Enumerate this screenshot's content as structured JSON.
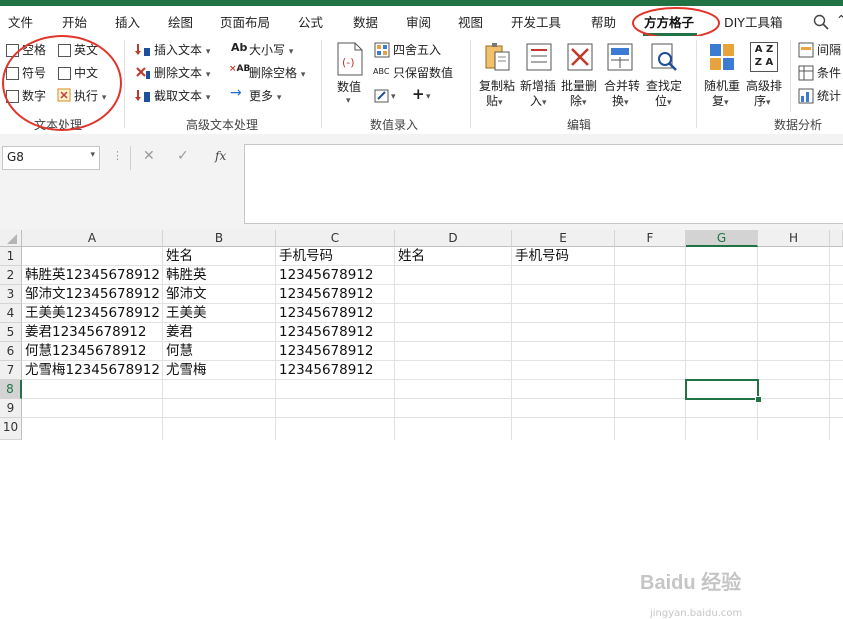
{
  "ribbon_tabs": [
    "文件",
    "开始",
    "插入",
    "绘图",
    "页面布局",
    "公式",
    "数据",
    "审阅",
    "视图",
    "开发工具",
    "帮助",
    "方方格子",
    "DIY工具箱"
  ],
  "active_tab": "方方格子",
  "colors": {
    "accent": "#217346",
    "highlight_circle": "#e0352b"
  },
  "text_group": {
    "checkboxes": [
      {
        "label": "空格",
        "checked": false
      },
      {
        "label": "英文",
        "checked": false
      },
      {
        "label": "符号",
        "checked": false
      },
      {
        "label": "中文",
        "checked": false
      },
      {
        "label": "数字",
        "checked": false
      }
    ],
    "execute_label": "执行",
    "title": "文本处理"
  },
  "advanced_text_group": {
    "insert_text": "插入文本",
    "delete_text": "删除文本",
    "truncate_text": "截取文本",
    "case": "大小写",
    "case_icon_text": "Ab",
    "delete_spaces": "删除空格",
    "delete_spaces_icon_text": "AB",
    "more": "更多",
    "title": "高级文本处理"
  },
  "numeric_group": {
    "value": "数值",
    "round": "四舍五入",
    "keep_numeric": "只保留数值",
    "keep_numeric_icon_text": "ABC",
    "title": "数值录入"
  },
  "edit_group": {
    "copy_paste_1": "复制粘",
    "copy_paste_2": "贴",
    "new_insert_1": "新增插",
    "new_insert_2": "入",
    "batch_delete_1": "批量删",
    "batch_delete_2": "除",
    "merge_convert_1": "合并转",
    "merge_convert_2": "换",
    "find_locate_1": "查找定",
    "find_locate_2": "位",
    "title": "编辑"
  },
  "analysis_group": {
    "random_repeat_1": "随机重",
    "random_repeat_2": "复",
    "advanced_sort_1": "高级排",
    "advanced_sort_2": "序",
    "sort_icon_top": "A Z",
    "sort_icon_bottom": "Z A",
    "interval_label": "间隔",
    "condition_label": "条件",
    "stats_label": "统计",
    "title": "数据分析"
  },
  "name_box": "G8",
  "fx_label": "fx",
  "columns": [
    "A",
    "B",
    "C",
    "D",
    "E",
    "F",
    "G",
    "H"
  ],
  "rows": [
    "1",
    "2",
    "3",
    "4",
    "5",
    "6",
    "7",
    "8",
    "9",
    "10"
  ],
  "cells": {
    "B1": "姓名",
    "C1": "手机号码",
    "D1": "姓名",
    "E1": "手机号码",
    "A2": "韩胜英12345678912",
    "B2": "韩胜英",
    "C2": "12345678912",
    "A3": "邹沛文12345678912",
    "B3": "邹沛文",
    "C3": "12345678912",
    "A4": "王美美12345678912",
    "B4": "王美美",
    "C4": "12345678912",
    "A5": "姜君12345678912",
    "B5": "姜君",
    "C5": "12345678912",
    "A6": "何慧12345678912",
    "B6": "何慧",
    "C6": "12345678912",
    "A7": "尤雪梅12345678912",
    "B7": "尤雪梅",
    "C7": "12345678912"
  },
  "watermark": {
    "main": "Baidu 经验",
    "sub": "jingyan.baidu.com"
  }
}
